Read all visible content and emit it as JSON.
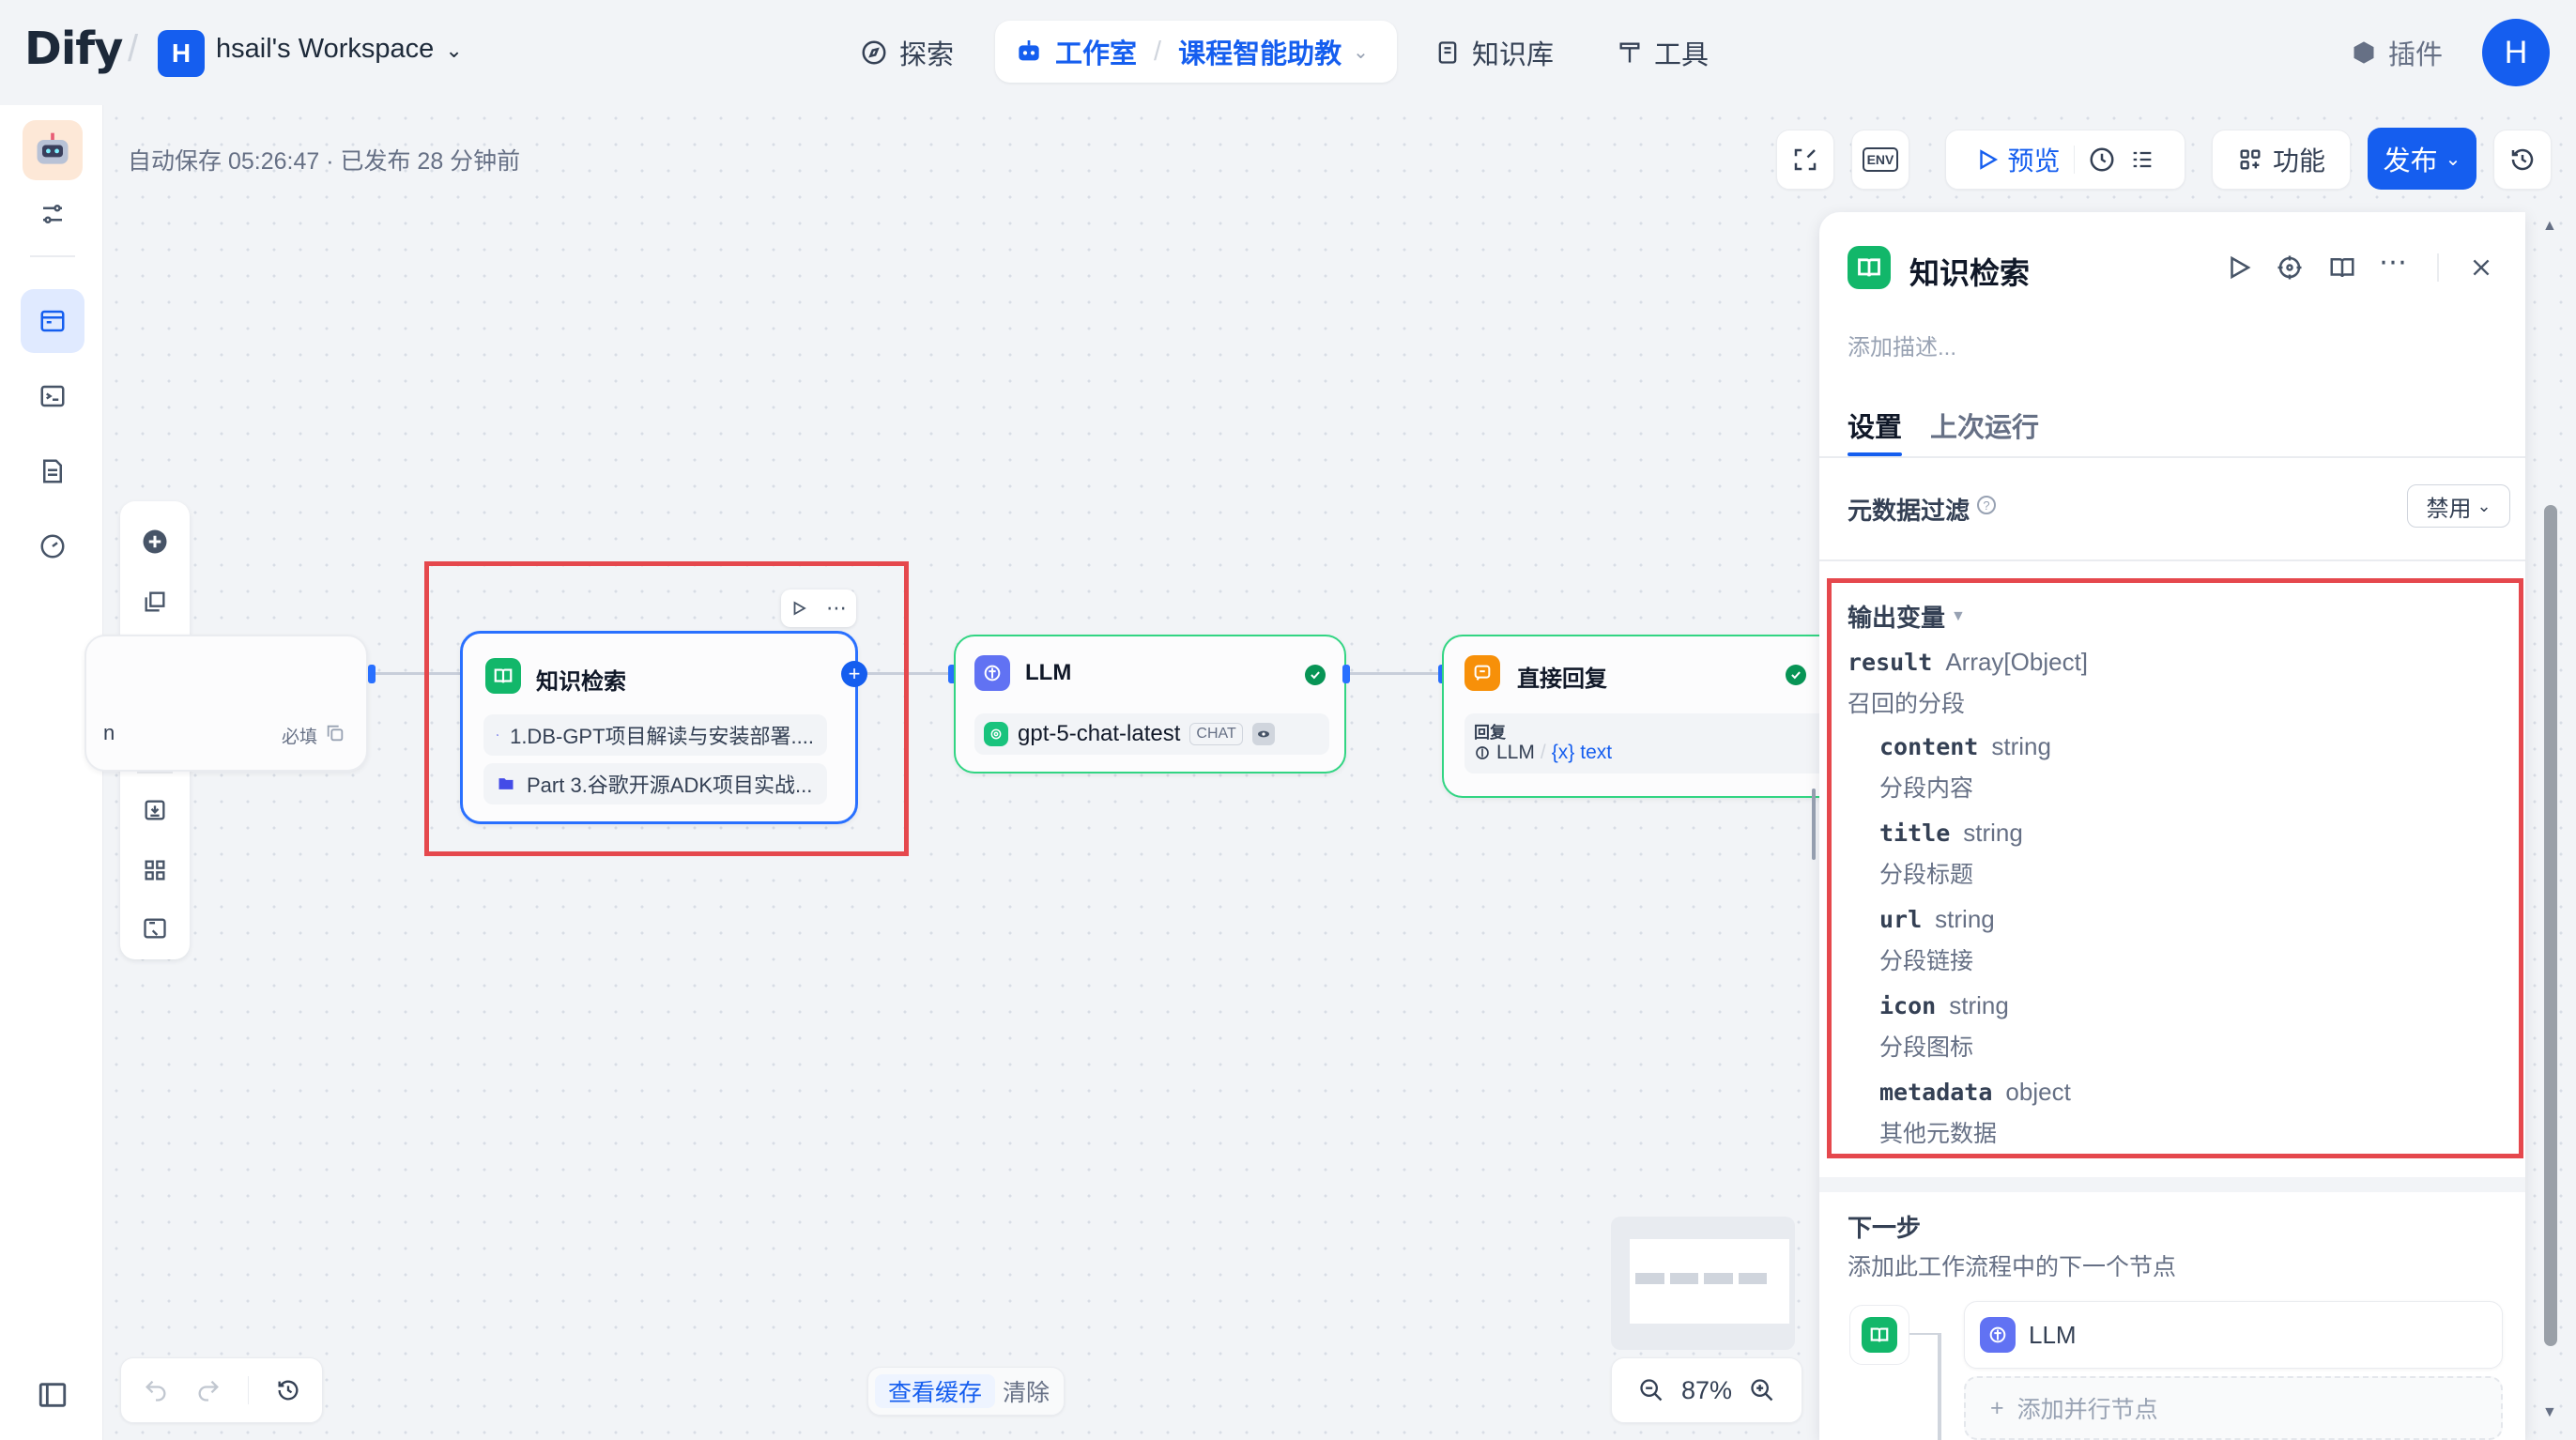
{
  "header": {
    "logo": "Dify",
    "workspace_initial": "H",
    "workspace_name": "hsail's Workspace",
    "nav": {
      "explore": "探索",
      "studio": "工作室",
      "app_name": "课程智能助教",
      "knowledge": "知识库",
      "tools": "工具",
      "plugins": "插件"
    },
    "user_initial": "H"
  },
  "toolbar": {
    "autosave": "自动保存 05:26:47 · 已发布 28 分钟前",
    "env_label": "ENV",
    "preview": "预览",
    "features": "功能",
    "publish": "发布"
  },
  "canvas": {
    "start_node_required": "必填",
    "start_node_partial": "n",
    "knowledge_node": {
      "title": "知识检索",
      "items": [
        "1.DB-GPT项目解读与安装部署....",
        "Part 3.谷歌开源ADK项目实战..."
      ]
    },
    "llm_node": {
      "title": "LLM",
      "model": "gpt-5-chat-latest",
      "model_tag": "CHAT"
    },
    "answer_node": {
      "title": "直接回复",
      "label": "回复",
      "var_source": "LLM",
      "var_name": "text"
    },
    "view_cache": "查看缓存",
    "clear": "清除",
    "zoom": "87%"
  },
  "panel": {
    "title": "知识检索",
    "desc_placeholder": "添加描述...",
    "tabs": {
      "settings": "设置",
      "last_run": "上次运行"
    },
    "metadata_filter": {
      "label": "元数据过滤",
      "value": "禁用"
    },
    "output_vars": {
      "heading": "输出变量",
      "result": {
        "name": "result",
        "type": "Array[Object]",
        "desc": "召回的分段"
      },
      "children": [
        {
          "name": "content",
          "type": "string",
          "desc": "分段内容"
        },
        {
          "name": "title",
          "type": "string",
          "desc": "分段标题"
        },
        {
          "name": "url",
          "type": "string",
          "desc": "分段链接"
        },
        {
          "name": "icon",
          "type": "string",
          "desc": "分段图标"
        },
        {
          "name": "metadata",
          "type": "object",
          "desc": "其他元数据"
        }
      ]
    },
    "next_step": {
      "heading": "下一步",
      "desc": "添加此工作流程中的下一个节点",
      "next_node": "LLM",
      "add_parallel": "添加并行节点"
    }
  },
  "colors": {
    "accent": "#155eef",
    "knowledge_green": "#12b76a",
    "llm_indigo": "#6172f3",
    "answer_orange": "#f79009",
    "highlight_red": "#e5484d"
  }
}
